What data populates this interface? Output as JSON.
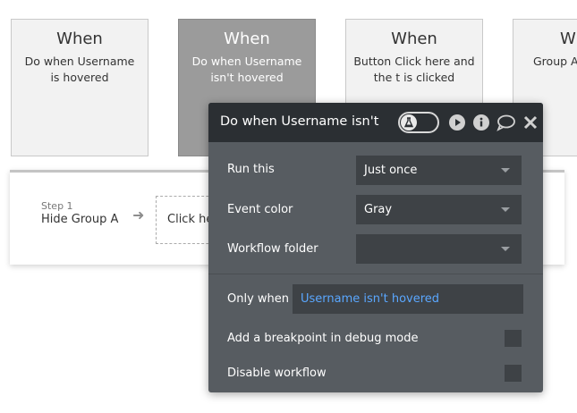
{
  "cards": [
    {
      "title": "When",
      "desc": "Do when Username is hovered"
    },
    {
      "title": "When",
      "desc": "Do when Username isn't hovered"
    },
    {
      "title": "When",
      "desc": "Button Click here and the t is clicked"
    },
    {
      "title": "Wh",
      "desc": "Group A"
    }
  ],
  "workflow": {
    "step_number": "Step 1",
    "step_name": "Hide Group A",
    "next_action_text": "Click here"
  },
  "panel": {
    "title": "Do when Username isn't",
    "icons": [
      "debug-toggle-flask-icon",
      "play-icon",
      "info-icon",
      "comment-icon",
      "close-icon"
    ],
    "run_this": {
      "label": "Run this",
      "value": "Just once"
    },
    "event_color": {
      "label": "Event color",
      "value": "Gray"
    },
    "workflow_folder": {
      "label": "Workflow folder",
      "value": ""
    },
    "only_when": {
      "label": "Only when",
      "value": "Username isn't hovered"
    },
    "breakpoint": {
      "label": "Add a breakpoint in debug mode"
    },
    "disable": {
      "label": "Disable workflow"
    }
  },
  "colors": {
    "panel_bg": "#575c61",
    "panel_header": "#2b2f33",
    "field_bg": "#3e4246",
    "link_blue": "#5aa7ff",
    "selected_card": "#9b9b9b"
  }
}
